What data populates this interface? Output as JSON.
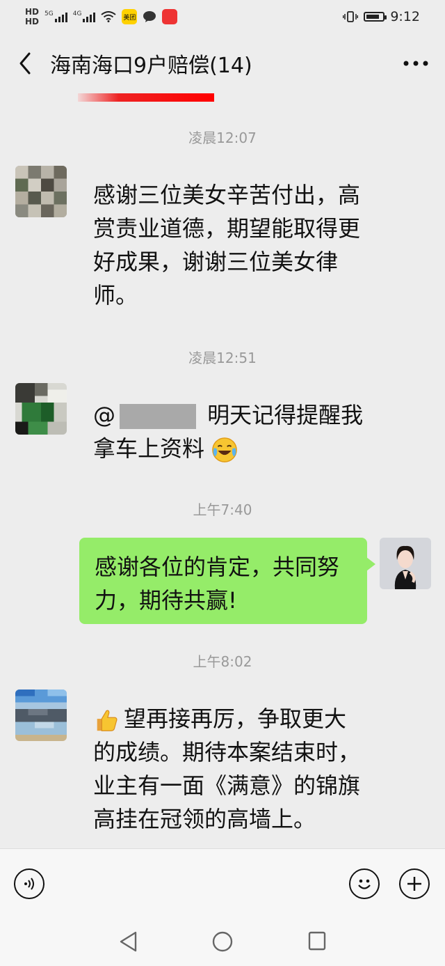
{
  "status_bar": {
    "left_icons": [
      "HD",
      "5G",
      "4G",
      "wifi-icon",
      "美团",
      "chat-bubble-icon",
      "app-icon"
    ],
    "time": "9:12"
  },
  "header": {
    "title": "海南海口9户赔偿(14)",
    "back_icon": "chevron-left-icon",
    "more_icon": "more-dots-icon"
  },
  "messages": [
    {
      "time": "凌晨12:07",
      "side": "left",
      "lines": [
        "感谢三位美女辛苦付出，高",
        "赏责业道德，期望能取得更",
        "好成果，谢谢三位美女律",
        "师。"
      ]
    },
    {
      "time": "凌晨12:51",
      "side": "left",
      "prefix": "@",
      "line1_rest": "明天记得提醒我",
      "line2": "拿车上资料"
    },
    {
      "time": "上午7:40",
      "side": "right",
      "lines": [
        "感谢各位的肯定，共同努",
        "力，期待共赢!"
      ]
    },
    {
      "time": "上午8:02",
      "side": "left",
      "lines": [
        "望再接再厉，争取更大",
        "的成绩。期待本案结束时，",
        "业主有一面《满意》的锦旗",
        "高挂在冠领的高墙上。"
      ]
    }
  ],
  "colors": {
    "self_bubble": "#95ec69",
    "background": "#ededed"
  }
}
